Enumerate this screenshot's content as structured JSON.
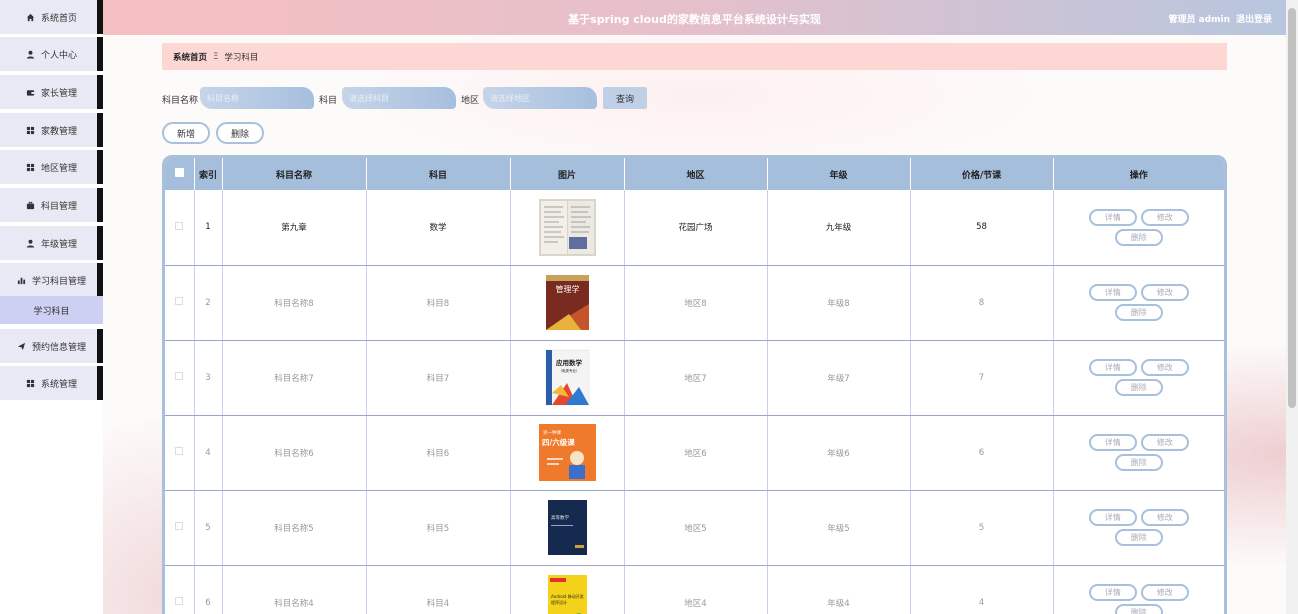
{
  "app": {
    "title": "基于spring cloud的家教信息平台系统设计与实现",
    "user_label": "管理员 admin",
    "logout_label": "退出登录"
  },
  "sidebar": {
    "items": [
      {
        "label": "系统首页",
        "icon": "home-icon"
      },
      {
        "label": "个人中心",
        "icon": "user-icon"
      },
      {
        "label": "家长管理",
        "icon": "wallet-icon"
      },
      {
        "label": "家教管理",
        "icon": "grid-icon"
      },
      {
        "label": "地区管理",
        "icon": "grid-icon"
      },
      {
        "label": "科目管理",
        "icon": "briefcase-icon"
      },
      {
        "label": "年级管理",
        "icon": "user-icon"
      },
      {
        "label": "学习科目管理",
        "icon": "bar-chart-icon"
      },
      {
        "label": "预约信息管理",
        "icon": "send-icon"
      },
      {
        "label": "系统管理",
        "icon": "grid-icon"
      }
    ],
    "sub_item": "学习科目"
  },
  "breadcrumb": {
    "home": "系统首页",
    "separator": "Ξ",
    "current": "学习科目"
  },
  "search": {
    "name_label": "科目名称",
    "name_placeholder": "科目名称",
    "subject_label": "科目",
    "subject_placeholder": "请选择科目",
    "region_label": "地区",
    "region_placeholder": "请选择地区",
    "query_label": "查询"
  },
  "actions": {
    "add_label": "新增",
    "delete_label": "删除"
  },
  "table": {
    "headers": [
      "",
      "索引",
      "科目名称",
      "科目",
      "图片",
      "地区",
      "年级",
      "价格/节课",
      "操作"
    ],
    "op_labels": {
      "detail": "详情",
      "edit": "修改",
      "delete": "删除"
    },
    "rows": [
      {
        "index": "1",
        "name": "第九章",
        "subject": "数学",
        "region": "花园广场",
        "grade": "九年级",
        "price": "58",
        "image": "notebook-photo"
      },
      {
        "index": "2",
        "name": "科目名称8",
        "subject": "科目8",
        "region": "地区8",
        "grade": "年级8",
        "price": "8",
        "image": "book-cover-management"
      },
      {
        "index": "3",
        "name": "科目名称7",
        "subject": "科目7",
        "region": "地区7",
        "grade": "年级7",
        "price": "7",
        "image": "book-cover-applied-math"
      },
      {
        "index": "4",
        "name": "科目名称6",
        "subject": "科目6",
        "region": "地区6",
        "grade": "年级6",
        "price": "6",
        "image": "book-cover-grade-four"
      },
      {
        "index": "5",
        "name": "科目名称5",
        "subject": "科目5",
        "region": "地区5",
        "grade": "年级5",
        "price": "5",
        "image": "book-cover-dark-blue"
      },
      {
        "index": "6",
        "name": "科目名称4",
        "subject": "科目4",
        "region": "地区4",
        "grade": "年级4",
        "price": "4",
        "image": "book-cover-yellow"
      }
    ]
  },
  "cover_text": {
    "management": "管理学",
    "applied_math": "应用数学",
    "applied_math_sub": "（电类专业）",
    "grade_four_top": "另一种课",
    "grade_four_main": "四/六级课",
    "dark_blue": "高等数学",
    "yellow_main": "Android 移动开发",
    "yellow_sub": "程序设计"
  },
  "colors": {
    "accent": "#a8c0dc",
    "breadcrumb_bg": "#fdd7d3",
    "sidebar_item_bg": "#e9e9f5",
    "sidebar_active_sub": "#cdd0f3"
  }
}
